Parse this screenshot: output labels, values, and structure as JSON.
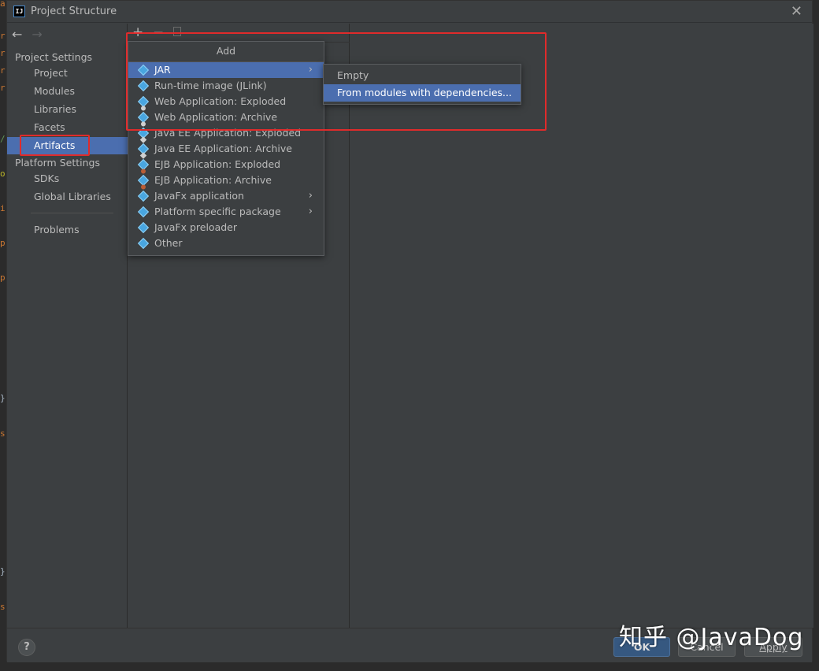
{
  "window": {
    "title": "Project Structure",
    "app_icon_text": "IJ"
  },
  "gutter": {
    "chars": [
      "a",
      "r",
      "r",
      "r",
      "r",
      "/",
      "o",
      "i",
      "p",
      "p",
      "}",
      "s",
      "}",
      "s"
    ]
  },
  "sidebar": {
    "sections": [
      {
        "label": "Project Settings"
      },
      {
        "label": "Platform Settings"
      }
    ],
    "items": [
      {
        "label": "Project"
      },
      {
        "label": "Modules"
      },
      {
        "label": "Libraries"
      },
      {
        "label": "Facets"
      },
      {
        "label": "Artifacts",
        "selected": true
      },
      {
        "label": "SDKs"
      },
      {
        "label": "Global Libraries"
      },
      {
        "label": "Problems"
      }
    ]
  },
  "toolbar": {
    "add": "+",
    "remove": "−"
  },
  "popup": {
    "title": "Add",
    "items": [
      {
        "label": "JAR",
        "icon": "artifact-icon",
        "submenu": true,
        "selected": true
      },
      {
        "label": "Run-time image (JLink)",
        "icon": "artifact-icon"
      },
      {
        "label": "Web Application: Exploded",
        "icon": "web-artifact-icon"
      },
      {
        "label": "Web Application: Archive",
        "icon": "web-artifact-icon"
      },
      {
        "label": "Java EE Application: Exploded",
        "icon": "javaee-artifact-icon"
      },
      {
        "label": "Java EE Application: Archive",
        "icon": "javaee-artifact-icon"
      },
      {
        "label": "EJB Application: Exploded",
        "icon": "ejb-artifact-icon"
      },
      {
        "label": "EJB Application: Archive",
        "icon": "ejb-artifact-icon"
      },
      {
        "label": "JavaFx application",
        "icon": "artifact-icon",
        "submenu": true
      },
      {
        "label": "Platform specific package",
        "icon": "artifact-icon",
        "submenu": true
      },
      {
        "label": "JavaFx preloader",
        "icon": "artifact-icon"
      },
      {
        "label": "Other",
        "icon": "artifact-icon"
      }
    ]
  },
  "submenu": {
    "items": [
      {
        "label": "Empty"
      },
      {
        "label": "From modules with dependencies...",
        "selected": true
      }
    ]
  },
  "footer": {
    "help": "?",
    "ok": "OK",
    "cancel": "Cancel",
    "apply": "Apply"
  },
  "watermark": "知乎 @JavaDog",
  "colors": {
    "selection": "#4b6eaf",
    "annotation_red": "#e02b2b",
    "panel_bg": "#3c3f41"
  }
}
